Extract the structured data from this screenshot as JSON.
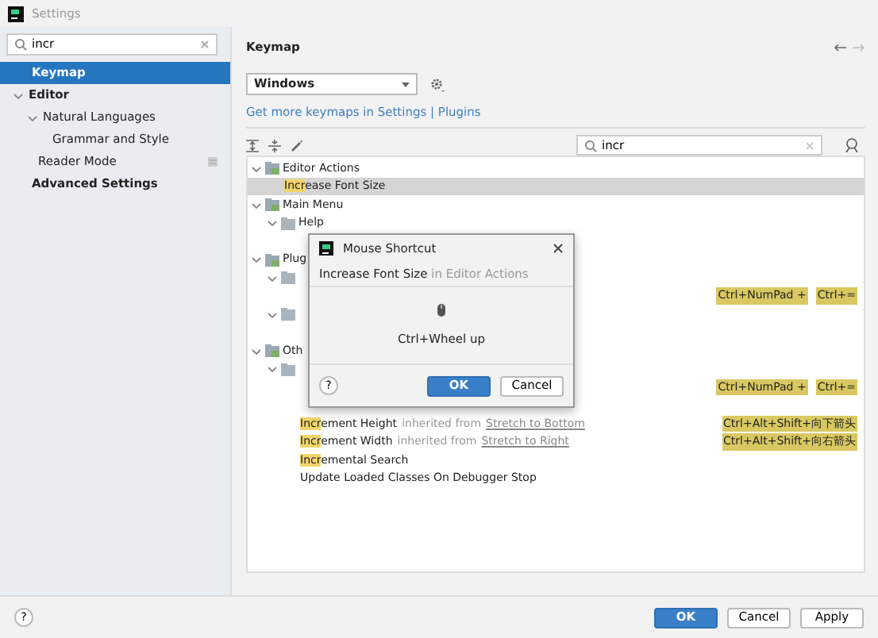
{
  "window": {
    "title": "Settings"
  },
  "sidebar": {
    "search": {
      "value": "incr"
    },
    "items": [
      {
        "label": "Keymap",
        "bold": true,
        "selected": true
      },
      {
        "label": "Editor",
        "bold": true,
        "selected": false,
        "expanded": true,
        "children": [
          {
            "label": "Natural Languages",
            "bold": false,
            "selected": false,
            "expanded": true,
            "children": [
              {
                "label": "Grammar and Style",
                "bold": false,
                "selected": false
              }
            ]
          },
          {
            "label": "Reader Mode",
            "bold": false,
            "selected": false,
            "modified": true
          }
        ]
      },
      {
        "label": "Advanced Settings",
        "bold": true,
        "selected": false
      }
    ]
  },
  "keymap": {
    "title": "Keymap",
    "scheme": "Windows",
    "link_text": "Get more keymaps in Settings | Plugins",
    "search": {
      "value": "incr"
    },
    "tree": [
      {
        "kind": "group",
        "label": "Editor Actions",
        "expanded": true,
        "children": [
          {
            "kind": "action",
            "highlight": "Incr",
            "label": "ease Font Size",
            "selected": true
          }
        ]
      },
      {
        "kind": "group",
        "label": "Main Menu",
        "expanded": true,
        "children": [
          {
            "kind": "folder",
            "label": "Help",
            "expanded": true,
            "children": [
              {
                "kind": "action"
              }
            ]
          }
        ]
      },
      {
        "kind": "group",
        "label": "Plug",
        "expanded": true,
        "children": [
          {
            "kind": "folder",
            "expanded": true,
            "children": [
              {
                "kind": "action",
                "shortcuts": [
                  "Ctrl+NumPad +",
                  "Ctrl+="
                ]
              }
            ]
          },
          {
            "kind": "folder",
            "expanded": true,
            "children": [
              {
                "kind": "action"
              }
            ]
          }
        ]
      },
      {
        "kind": "group",
        "label": "Oth",
        "expanded": true,
        "children": [
          {
            "kind": "folder",
            "expanded": true,
            "children": [
              {
                "kind": "action",
                "shortcuts": [
                  "Ctrl+NumPad +",
                  "Ctrl+="
                ]
              },
              {
                "kind": "action"
              },
              {
                "kind": "action",
                "highlight": "Incr",
                "label": "ement Height",
                "inherited": "inherited from",
                "source": "Stretch to Bottom",
                "shortcuts": [
                  "Ctrl+Alt+Shift+向下箭头"
                ]
              },
              {
                "kind": "action",
                "highlight": "Incr",
                "label": "ement Width",
                "inherited": "inherited from",
                "source": "Stretch to Right",
                "shortcuts": [
                  "Ctrl+Alt+Shift+向右箭头"
                ]
              },
              {
                "kind": "action",
                "highlight": "Incr",
                "label": "emental Search"
              },
              {
                "kind": "action",
                "label": "Update Loaded Classes On Debugger Stop"
              }
            ]
          }
        ]
      }
    ]
  },
  "dialog": {
    "title": "Mouse Shortcut",
    "action": "Increase Font Size",
    "context": "in Editor Actions",
    "shortcut": "Ctrl+Wheel up",
    "ok": "OK",
    "cancel": "Cancel",
    "help": "?"
  },
  "footer": {
    "help": "?",
    "buttons": [
      {
        "label": "OK",
        "primary": true
      },
      {
        "label": "Cancel",
        "primary": false
      },
      {
        "label": "Apply",
        "primary": false
      }
    ]
  }
}
